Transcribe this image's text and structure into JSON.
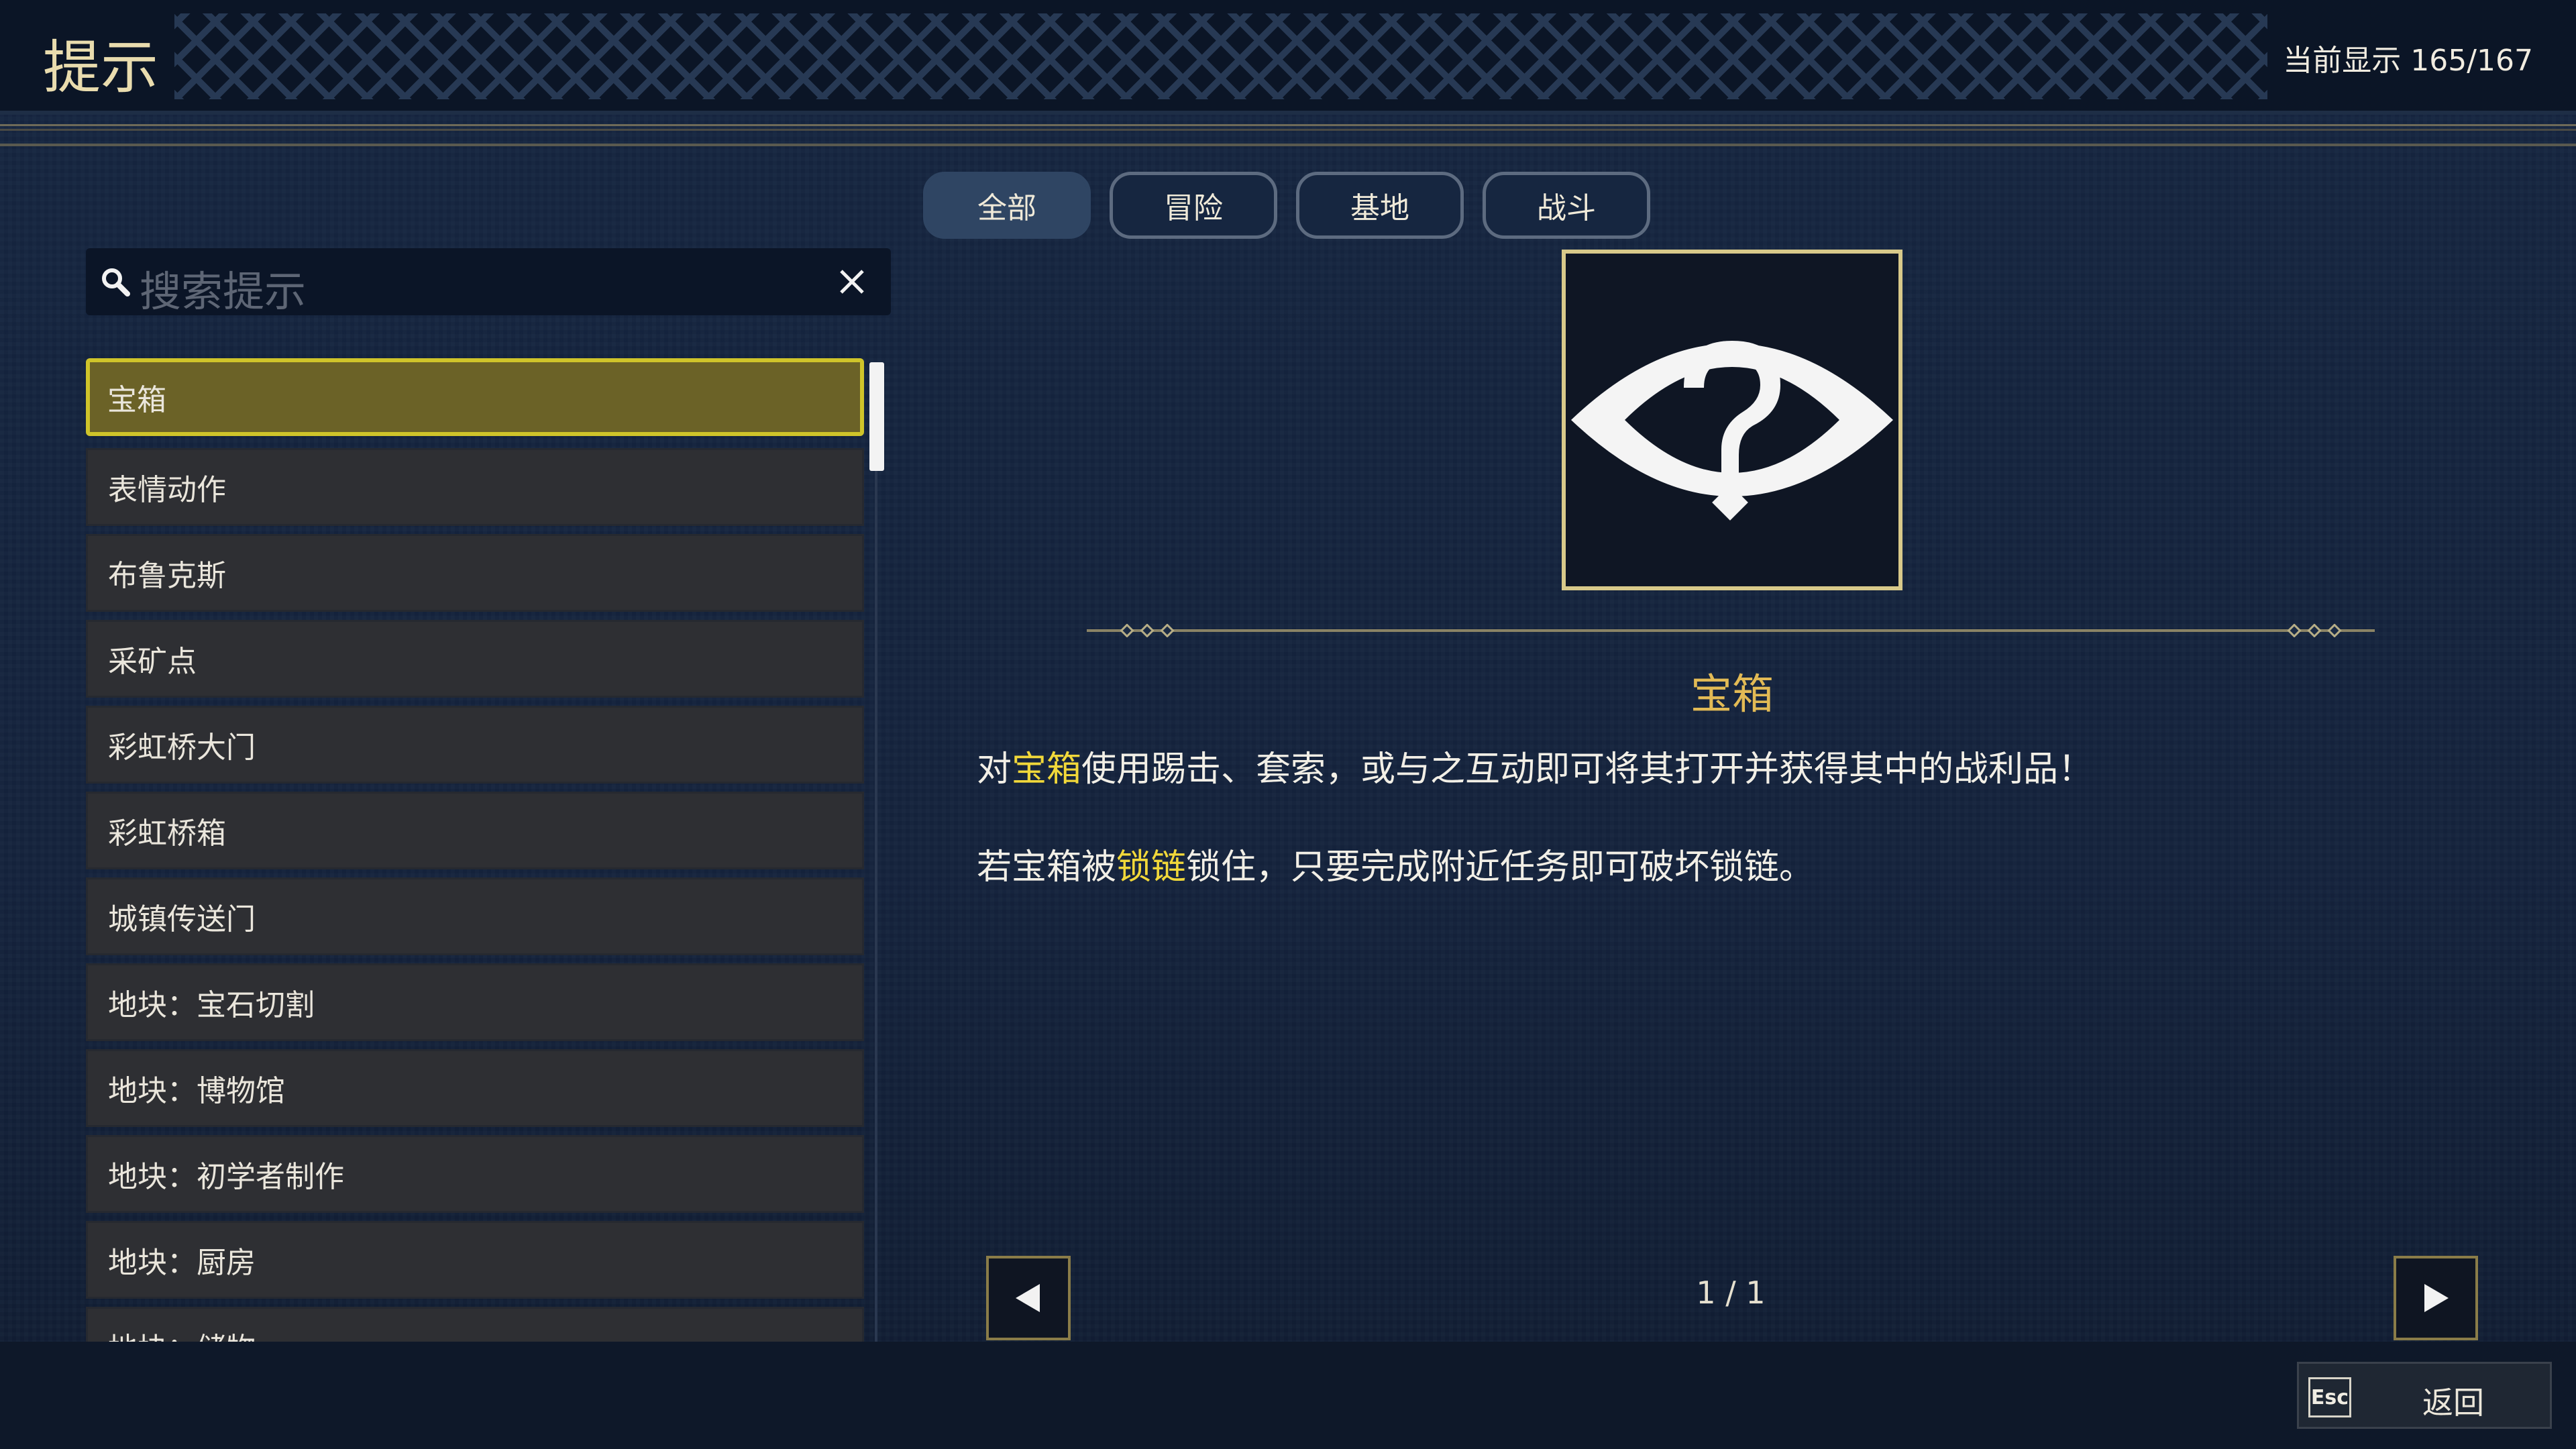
{
  "header": {
    "title": "提示",
    "display_count": "当前显示 165/167"
  },
  "tabs": [
    {
      "label": "全部",
      "active": true
    },
    {
      "label": "冒险",
      "active": false
    },
    {
      "label": "基地",
      "active": false
    },
    {
      "label": "战斗",
      "active": false
    }
  ],
  "search": {
    "placeholder": "搜索提示",
    "icon": "search-icon",
    "clear_icon": "close-icon"
  },
  "list": {
    "items": [
      {
        "label": "宝箱",
        "selected": true
      },
      {
        "label": "表情动作"
      },
      {
        "label": "布鲁克斯"
      },
      {
        "label": "采矿点"
      },
      {
        "label": "彩虹桥大门"
      },
      {
        "label": "彩虹桥箱"
      },
      {
        "label": "城镇传送门"
      },
      {
        "label": "地块：宝石切割"
      },
      {
        "label": "地块：博物馆"
      },
      {
        "label": "地块：初学者制作"
      },
      {
        "label": "地块：厨房"
      },
      {
        "label": "地块：储物"
      }
    ]
  },
  "detail": {
    "image_icon": "eye-question-icon",
    "title": "宝箱",
    "paragraph1": {
      "pre": "对",
      "hl": "宝箱",
      "post": "使用踢击、套索，或与之互动即可将其打开并获得其中的战利品！"
    },
    "paragraph2": {
      "pre": "若宝箱被",
      "hl": "锁链",
      "post": "锁住，只要完成附近任务即可破坏锁链。"
    }
  },
  "pager": {
    "indicator": "1 / 1",
    "prev_icon": "triangle-left-icon",
    "next_icon": "triangle-right-icon"
  },
  "footer": {
    "esc_key": "Esc",
    "back_label": "返回"
  },
  "colors": {
    "accent_gold": "#e2ba55",
    "highlight_yellow": "#f1d83a",
    "selected_item": "#6b6227",
    "selected_border": "#cfc42a"
  }
}
